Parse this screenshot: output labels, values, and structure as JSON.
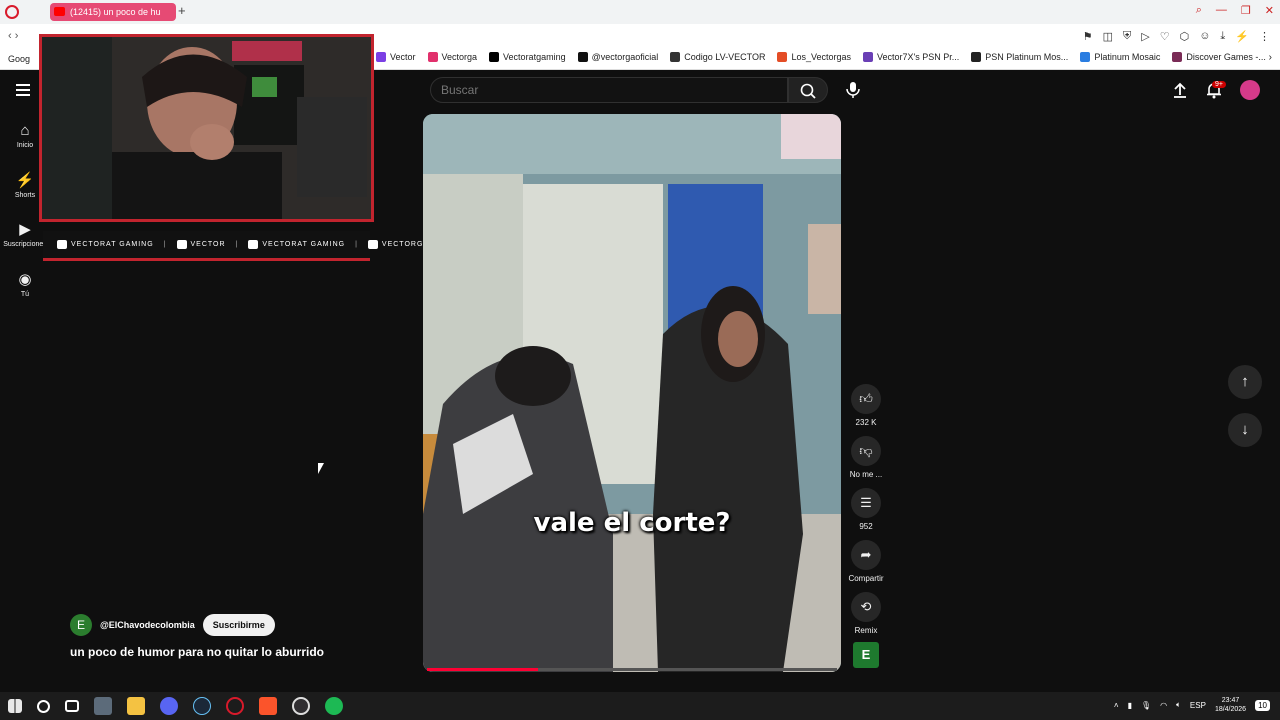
{
  "browser": {
    "tab_title": "(12415) un poco de hu",
    "new_tab": "+",
    "bookmarks_first": "Goog",
    "bookmarks": [
      {
        "label": "Vector",
        "color": "#7b3fe4"
      },
      {
        "label": "Vectorga",
        "color": "#e1306c"
      },
      {
        "label": "Vectoratgaming",
        "color": "#000000"
      },
      {
        "label": "@vectorgaoficial",
        "color": "#111111"
      },
      {
        "label": "Codigo LV-VECTOR",
        "color": "#333333"
      },
      {
        "label": "Los_Vectorgas",
        "color": "#e44d26"
      },
      {
        "label": "Vector7X's PSN Pr...",
        "color": "#6a3fb5"
      },
      {
        "label": "PSN Platinum Mos...",
        "color": "#222222"
      },
      {
        "label": "Platinum Mosaic",
        "color": "#2a7de1"
      },
      {
        "label": "Discover Games -...",
        "color": "#7a2b56"
      }
    ]
  },
  "youtube": {
    "search_placeholder": "Buscar",
    "notification_count": "9+",
    "rail": [
      {
        "label": "Inicio",
        "icon": "home-icon",
        "glyph": "⌂"
      },
      {
        "label": "Shorts",
        "icon": "shorts-icon",
        "glyph": "⚡"
      },
      {
        "label": "Suscripciones",
        "icon": "subscriptions-icon",
        "glyph": "▶"
      },
      {
        "label": "Tú",
        "icon": "account-icon",
        "glyph": "◉"
      }
    ],
    "subtitle": "vale el corte?",
    "progress": 0.27,
    "actions": {
      "likes": "232 K",
      "dislike": "No me ...",
      "comments": "952",
      "share": "Compartir",
      "remix": "Remix"
    },
    "channel": {
      "initial": "E",
      "handle": "@ElChavodecolombia",
      "subscribe_label": "Suscribirme"
    },
    "title": "un poco de humor para no quitar lo aburrido"
  },
  "stream_overlay": {
    "socials": [
      {
        "icon": "youtube-icon",
        "label": "VECTORAT GAMING"
      },
      {
        "icon": "twitch-icon",
        "label": "VECTOR"
      },
      {
        "icon": "twitter-icon",
        "label": "VECTORAT GAMING"
      },
      {
        "icon": "instagram-icon",
        "label": "VECTORGA"
      }
    ]
  },
  "taskbar": {
    "language": "ESP",
    "time": "23:47",
    "date": "18/4/2026",
    "notification_count": "10"
  },
  "colors": {
    "accent": "#ff0033",
    "frame": "#c2242e",
    "background": "#0f0f0f"
  }
}
